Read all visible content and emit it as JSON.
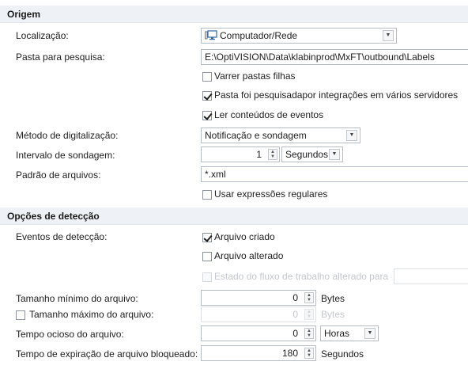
{
  "origem": {
    "header": "Origem",
    "localizacao": {
      "label": "Localização:",
      "value": "Computador/Rede",
      "icon": "monitor-icon"
    },
    "pasta": {
      "label": "Pasta para pesquisa:",
      "value": "E:\\OptiVISION\\Data\\klabinprod\\MxFT\\outbound\\Labels"
    },
    "varrer": {
      "label": "Varrer pastas filhas",
      "checked": false
    },
    "pasta_pesquisada": {
      "label": "Pasta foi pesquisadapor integrações em vários servidores",
      "checked": true
    },
    "ler_conteudos": {
      "label": "Ler conteúdos de eventos",
      "checked": true
    },
    "metodo": {
      "label": "Método de digitalização:",
      "value": "Notificação e sondagem"
    },
    "intervalo": {
      "label": "Intervalo de sondagem:",
      "value": "1",
      "unit": "Segundos"
    },
    "padrao": {
      "label": "Padrão de arquivos:",
      "value": "*.xml"
    },
    "usar_regex": {
      "label": "Usar expressões regulares",
      "checked": false
    }
  },
  "deteccao": {
    "header": "Opções de detecção",
    "eventos_label": "Eventos de detecção:",
    "arquivo_criado": {
      "label": "Arquivo criado",
      "checked": true
    },
    "arquivo_alterado": {
      "label": "Arquivo alterado",
      "checked": false
    },
    "estado_fluxo": {
      "label": "Estado do fluxo de trabalho alterado para",
      "checked": false,
      "value": ""
    },
    "tamanho_min": {
      "label": "Tamanho mínimo do arquivo:",
      "value": "0",
      "unit": "Bytes"
    },
    "tamanho_max": {
      "label": "Tamanho máximo do arquivo:",
      "value": "0",
      "unit": "Bytes",
      "checked": false
    },
    "tempo_ocioso": {
      "label": "Tempo ocioso do arquivo:",
      "value": "0",
      "unit": "Horas"
    },
    "tempo_expiracao": {
      "label": "Tempo de expiração de arquivo bloqueado:",
      "value": "180",
      "unit": "Segundos"
    }
  }
}
